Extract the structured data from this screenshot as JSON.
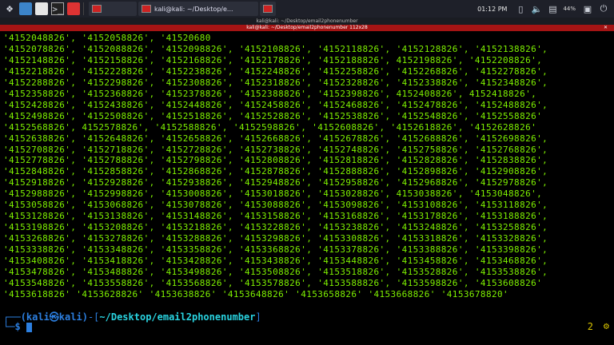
{
  "panel": {
    "task1_label": "kali@kali: ~/Desktop/e...",
    "clock": "01:12 PM",
    "battery": "44%",
    "icons": [
      "kali-menu-icon",
      "workspace-blue-icon",
      "files-icon",
      "terminal-icon",
      "browser-icon",
      "show-desktop-icon",
      "notification-icon",
      "volume-icon",
      "network-icon",
      "battery-icon",
      "power-icon"
    ]
  },
  "window": {
    "title": "kali@kali: ~/Desktop/email2phonenumber",
    "tab_title": "kali@kali: ~/Desktop/email2phonenumber 112x28"
  },
  "terminal": {
    "lines": [
      "'4152048826', '4152058826', '41520680",
      "'4152078826', '4152088826', '4152098826', '4152108826', '4152118826', '4152128826', '4152138826',",
      "'4152148826', '4152158826', '4152168826', '4152178826', '4152188826', 4152198826', '4152208826',",
      "'4152218826', '4152228826', '4152238826', '4152248826', '4152258826', '4152268826', '4152278826',",
      "'4152288826', '4152298826', '4152308826', '4152318826', '4152328826', '4152338826', '4152348826',",
      "'4152358826', '4152368826', '4152378826', '4152388826', '4152398826', 4152408826', 4152418826',",
      "'4152428826', '4152438826', '4152448826', '4152458826', '4152468826', '4152478826', '4152488826',",
      "'4152498826', '4152508826', '4152518826', '4152528826', '4152538826', '4152548826', '4152558826'",
      "'4152568826', 4152578826', '4152588826', '4152598826', '4152608826', '4152618826', '4152628826'",
      "'4152638826', '4152648826', '4152658826', '4152668826', '4152678826', '4152688826', '4152698826',",
      "'4152708826', '4152718826', '4152728826', '4152738826', '4152748826', '4152758826', '4152768826',",
      "'4152778826', '4152788826', '4152798826', '4152808826', '4152818826', '4152828826', '4152838826',",
      "'4152848826', '4152858826', '4152868826', '4152878826', '4152888826', '4152898826', '4152908826',",
      "'4152918826', '4152928826', '4152938826', '4152948826', '4152958826', '4152968826', '4152978826',",
      "'4152988826', '4152998826', '4153008826', '4153018826', '4153028826', 4153038826', '4153048826',",
      "'4153058826', '4153068826', '4153078826', '4153088826', '4153098826', '4153108826', '4153118826',",
      "'4153128826', '4153138826', '4153148826', '4153158826', '4153168826', '4153178826', '4153188826',",
      "'4153198826', '4153208826', '4153218826', '4153228826', '4153238826', '4153248826', '4153258826',",
      "'4153268826', '4153278826', '4153288826', '4153298826', '4153308826', '4153318826', '4153328826',",
      "'4153338826', '4153348826', '4153358826', '4153368826', '4153378826', '4153388826', '4153398826',",
      "'4153408826', '4153418826', '4153428826', '4153438826', '4153448826', '4153458826', '4153468826',",
      "'4153478826', '4153488826', '4153498826', '4153508826', '4153518826', '4153528826', '4153538826',",
      "'4153548826', '4153558826', '4153568826', '4153578826', '4153588826', '4153598826', '4153608826'",
      "'4153618826' '4153628826' '4153638826' '4153648826' '4153658826' '4153668826' '4153678820'"
    ],
    "prompt": {
      "user_host": "(kali㉿kali)",
      "dash": "-[",
      "path": "~/Desktop/email2phonenumber",
      "close": "]",
      "corner_top": "┌──",
      "corner_bottom": "└─",
      "symbol": "$"
    },
    "job_count": "2",
    "colors": {
      "output": "#7ef000",
      "prompt": "#2c7fe0",
      "path": "#29d3e0",
      "tab": "#a51414"
    }
  }
}
